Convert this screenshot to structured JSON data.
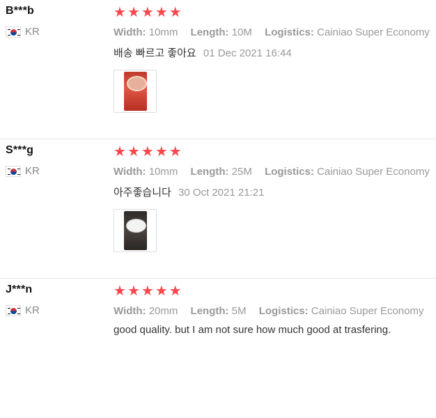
{
  "reviews": [
    {
      "user": "B***b",
      "country": "KR",
      "stars": 5,
      "width_label": "Width:",
      "width_value": "10mm",
      "length_label": "Length:",
      "length_value": "10M",
      "logistics_label": "Logistics:",
      "logistics_value": "Cainiao Super Economy",
      "text": "배송 빠르고 좋아요",
      "date": "01 Dec 2021 16:44",
      "photo": "photo-red"
    },
    {
      "user": "S***g",
      "country": "KR",
      "stars": 5,
      "width_label": "Width:",
      "width_value": "10mm",
      "length_label": "Length:",
      "length_value": "25M",
      "logistics_label": "Logistics:",
      "logistics_value": "Cainiao Super Economy",
      "text": "아주좋습니다",
      "date": "30 Oct 2021 21:21",
      "photo": "photo-dark"
    },
    {
      "user": "J***n",
      "country": "KR",
      "stars": 5,
      "width_label": "Width:",
      "width_value": "20mm",
      "length_label": "Length:",
      "length_value": "5M",
      "logistics_label": "Logistics:",
      "logistics_value": "Cainiao Super Economy",
      "text": "good quality. but I am not sure how much good at trasfering.",
      "date": "",
      "photo": ""
    }
  ],
  "colors": {
    "star": "#f5484d",
    "muted": "#999999"
  }
}
